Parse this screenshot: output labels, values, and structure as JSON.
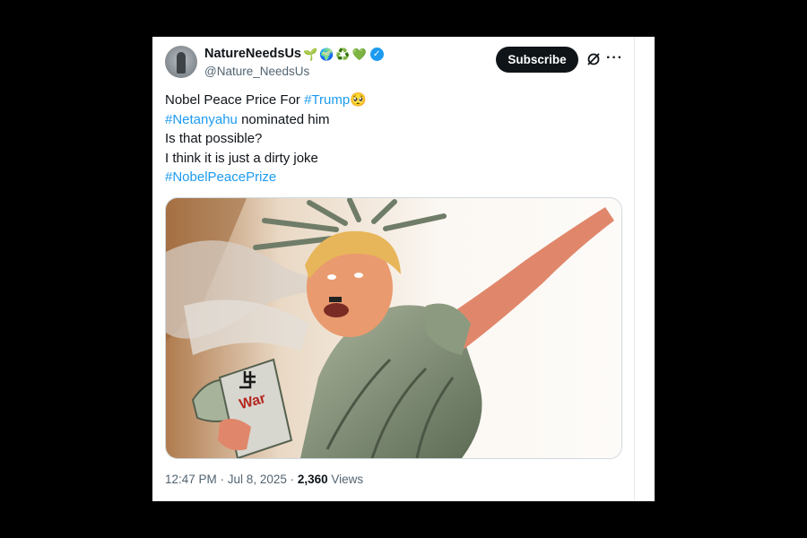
{
  "author": {
    "display_name": "NatureNeedsUs",
    "emojis": [
      "🌱",
      "🌍",
      "♻️",
      "💚"
    ],
    "handle": "@Nature_NeedsUs",
    "verified_badge": "✓"
  },
  "actions": {
    "subscribe_label": "Subscribe",
    "grok_icon": "grok-icon",
    "more_label": "···"
  },
  "tweet": {
    "line1_text": "Nobel Peace Price For ",
    "line1_tag": "#Trump",
    "line1_emoji": "🥺",
    "line2_tag": "#Netanyahu",
    "line2_text": " nominated him",
    "line3": "Is that possible?",
    "line4": "I think it is just a dirty joke",
    "line5_tag": "#NobelPeacePrize"
  },
  "media": {
    "sign_text": "War",
    "description_icon": "caricature-image"
  },
  "meta": {
    "time": "12:47 PM",
    "sep1": " · ",
    "date": "Jul 8, 2025",
    "sep2": " · ",
    "views": "2,360",
    "views_label": " Views"
  },
  "colors": {
    "link": "#1d9bf0",
    "text": "#0f1419",
    "secondary": "#536471",
    "subscribe_bg": "#0f1419"
  }
}
